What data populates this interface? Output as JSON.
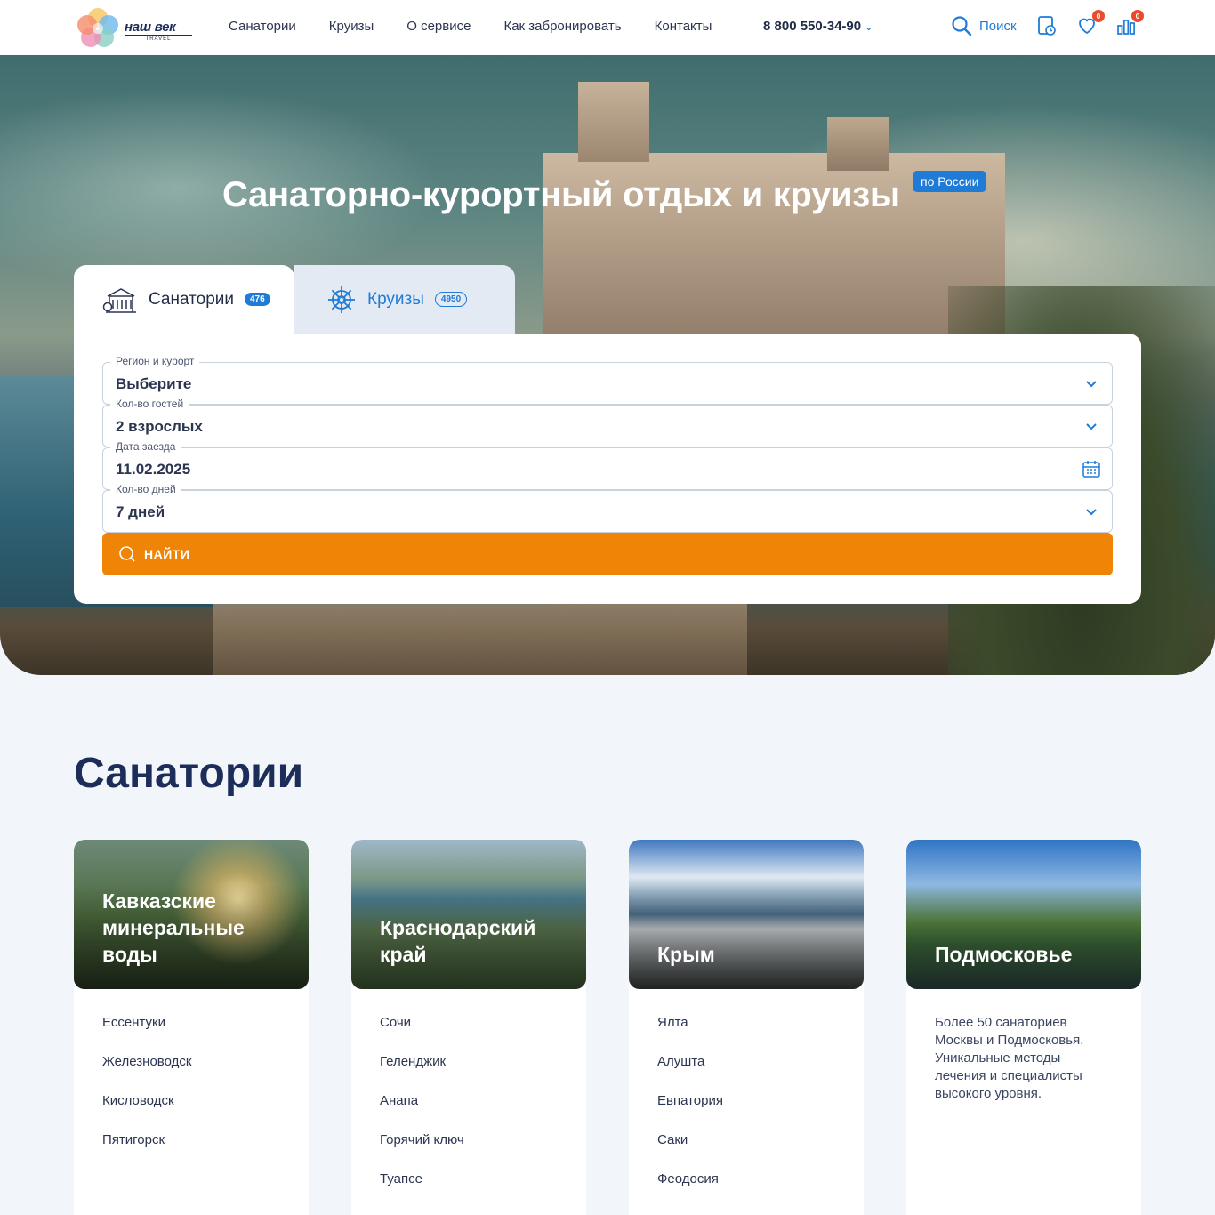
{
  "header": {
    "logo_text": "наш век",
    "logo_sub": "TRAVEL",
    "nav": [
      "Санатории",
      "Круизы",
      "О сервисе",
      "Как забронировать",
      "Контакты"
    ],
    "phone": "8 800 550-34-90",
    "search_label": "Поиск",
    "favorites_count": "0",
    "compare_count": "0"
  },
  "hero": {
    "title": "Санаторно-курортный отдых и круизы",
    "tag": "по России"
  },
  "search": {
    "tabs": [
      {
        "label": "Санатории",
        "count": "476"
      },
      {
        "label": "Круизы",
        "count": "4950"
      }
    ],
    "fields": [
      {
        "label": "Регион и курорт",
        "value": "Выберите"
      },
      {
        "label": "Кол-во гостей",
        "value": "2 взрослых"
      },
      {
        "label": "Дата заезда",
        "value": "11.02.2025"
      },
      {
        "label": "Кол-во дней",
        "value": "7 дней"
      }
    ],
    "find_label": "НАЙТИ"
  },
  "sanatoriums": {
    "title": "Санатории",
    "cards": [
      {
        "title": "Кавказские минеральные воды",
        "items": [
          "Ессентуки",
          "Железноводск",
          "Кисловодск",
          "Пятигорск"
        ]
      },
      {
        "title": "Краснодарский край",
        "items": [
          "Сочи",
          "Геленджик",
          "Анапа",
          "Горячий ключ",
          "Туапсе"
        ]
      },
      {
        "title": "Крым",
        "items": [
          "Ялта",
          "Алушта",
          "Евпатория",
          "Саки",
          "Феодосия"
        ]
      },
      {
        "title": "Подмосковье",
        "description": "Более 50 санаториев Москвы и Подмосковья. Уникальные методы лечения и специалисты высокого уровня."
      }
    ]
  },
  "colors": {
    "accent": "#1f7bd6",
    "cta": "#ef8406",
    "dark": "#1c2d5a",
    "badge": "#ea4b2c"
  }
}
